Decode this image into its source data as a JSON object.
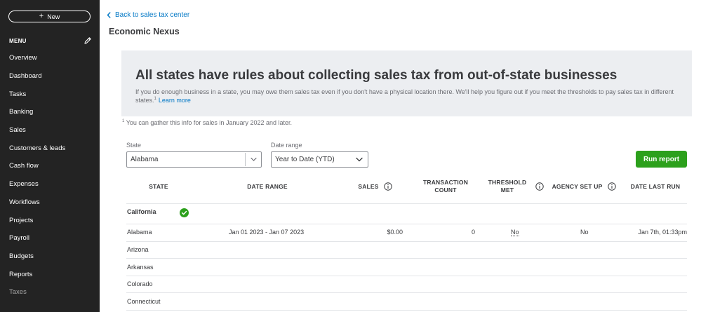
{
  "sidebar": {
    "new_label": "New",
    "menu_label": "MENU",
    "items": [
      {
        "label": "Overview"
      },
      {
        "label": "Dashboard"
      },
      {
        "label": "Tasks"
      },
      {
        "label": "Banking"
      },
      {
        "label": "Sales"
      },
      {
        "label": "Customers & leads"
      },
      {
        "label": "Cash flow"
      },
      {
        "label": "Expenses"
      },
      {
        "label": "Workflows"
      },
      {
        "label": "Projects"
      },
      {
        "label": "Payroll"
      },
      {
        "label": "Budgets"
      },
      {
        "label": "Reports"
      },
      {
        "label": "Taxes"
      }
    ]
  },
  "header": {
    "back_link": "Back to sales tax center",
    "title": "Economic Nexus"
  },
  "banner": {
    "title": "All states have rules about collecting sales tax from out-of-state businesses",
    "text": "If you do enough business in a state, you may owe them sales tax even if you don't have a physical location there. We'll help you figure out if you meet the thresholds to pay sales tax in different states.",
    "sup": "1",
    "learn_more": "Learn more"
  },
  "footnote": {
    "sup": "1",
    "text": "You can gather this info for sales in January 2022 and later."
  },
  "filters": {
    "state_label": "State",
    "state_value": "Alabama",
    "range_label": "Date range",
    "range_value": "Year to Date (YTD)",
    "run_label": "Run report"
  },
  "table": {
    "headers": {
      "state": "STATE",
      "date_range": "DATE RANGE",
      "sales": "SALES",
      "transaction_line1": "TRANSACTION",
      "transaction_line2": "COUNT",
      "threshold_line1": "THRESHOLD",
      "threshold_line2": "MET",
      "agency": "AGENCY SET UP",
      "last_run": "DATE LAST RUN"
    },
    "group": "California",
    "rows": [
      {
        "state": "Alabama",
        "date_range": "Jan 01 2023 - Jan 07 2023",
        "sales": "$0.00",
        "count": "0",
        "threshold": "No",
        "agency": "No",
        "last_run": "Jan 7th, 01:33pm"
      },
      {
        "state": "Arizona"
      },
      {
        "state": "Arkansas"
      },
      {
        "state": "Colorado"
      },
      {
        "state": "Connecticut"
      }
    ]
  },
  "colors": {
    "sidebar_bg": "#232323",
    "accent_blue": "#0077c5",
    "run_green": "#2ca01c",
    "banner_bg": "#eceef1"
  }
}
